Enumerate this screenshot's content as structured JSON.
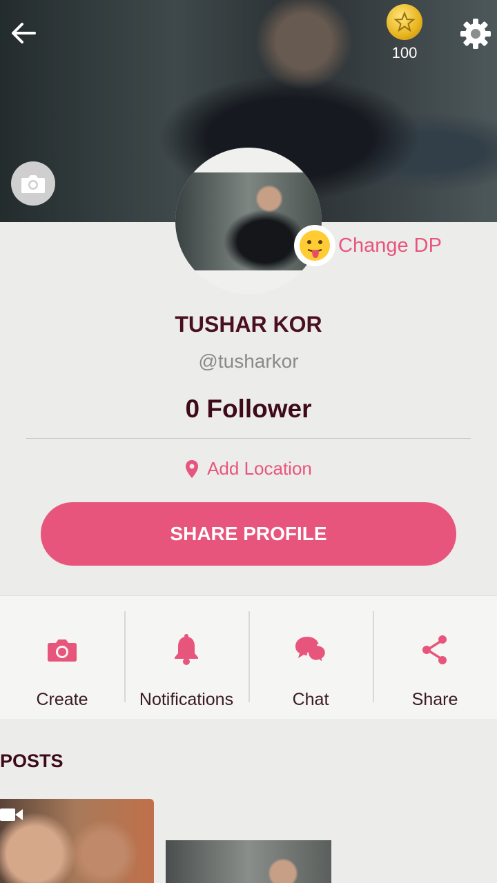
{
  "header": {
    "coin_count": "100"
  },
  "profile": {
    "change_dp_label": "Change DP",
    "name": "TUSHAR KOR",
    "handle": "@tusharkor",
    "followers": "0 Follower",
    "location_label": "Add Location",
    "share_button": "SHARE PROFILE"
  },
  "actions": [
    {
      "label": "Create",
      "icon": "camera-icon"
    },
    {
      "label": "Notifications",
      "icon": "bell-icon"
    },
    {
      "label": "Chat",
      "icon": "chat-bubbles-icon"
    },
    {
      "label": "Share",
      "icon": "share-icon"
    }
  ],
  "posts": {
    "title": "POSTS"
  },
  "colors": {
    "accent": "#e8557c",
    "name": "#4a1020",
    "background": "#ececea"
  }
}
